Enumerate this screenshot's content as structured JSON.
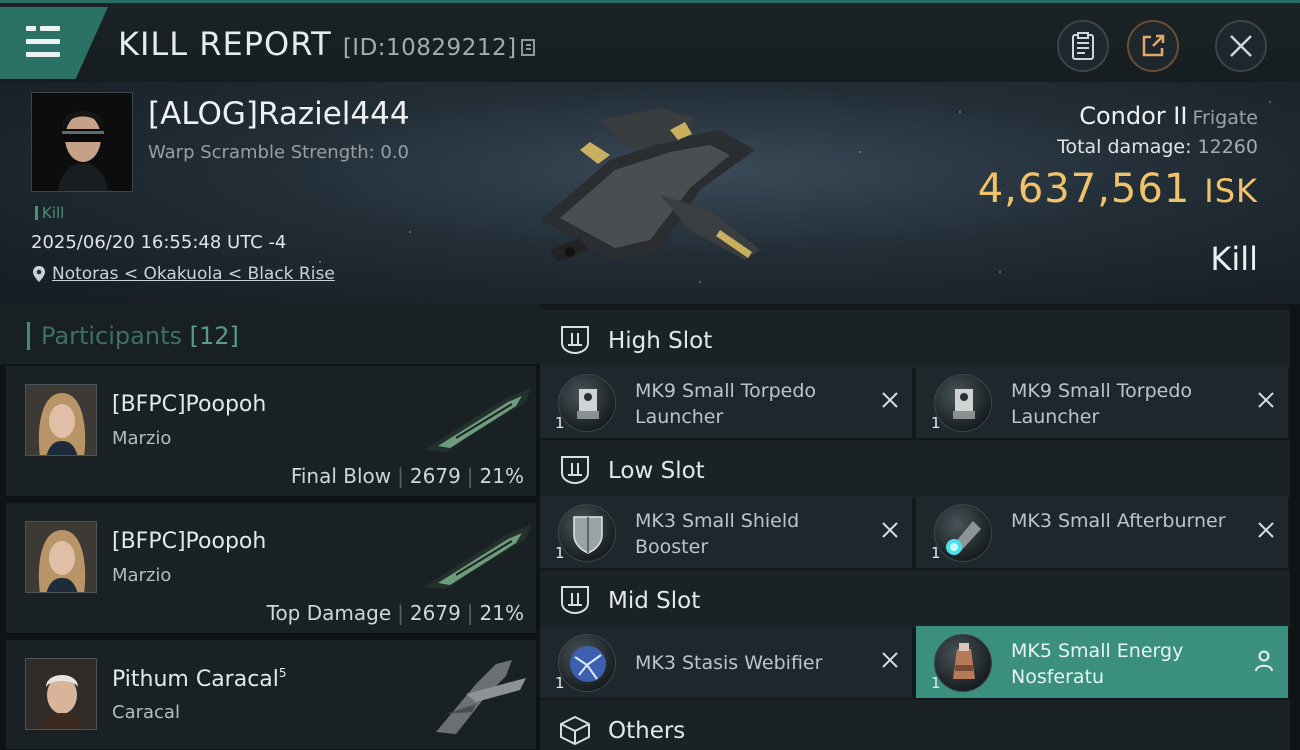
{
  "header": {
    "title": "KILL REPORT",
    "report_id": "[ID:10829212]"
  },
  "victim": {
    "name": "[ALOG]Raziel444",
    "warp_scramble": "Warp Scramble Strength: 0.0",
    "tag": "Kill",
    "time": "2025/06/20 16:55:48 UTC -4",
    "location": "Notoras < Okakuola < Black Rise",
    "ship_name": "Condor II",
    "ship_class": "Frigate",
    "damage_label": "Total damage:",
    "damage_value": "12260",
    "isk_value": "4,637,561",
    "isk_unit": "ISK",
    "result": "Kill"
  },
  "participants": {
    "title": "Participants",
    "count": "[12]",
    "rows": [
      {
        "name": "[BFPC]Poopoh",
        "ship": "Marzio",
        "label": "Final Blow",
        "damage": "2679",
        "percent": "21%"
      },
      {
        "name": "[BFPC]Poopoh",
        "ship": "Marzio",
        "label": "Top Damage",
        "damage": "2679",
        "percent": "21%"
      },
      {
        "name": "Pithum Caracal",
        "sup": "5",
        "ship": "Caracal"
      }
    ]
  },
  "fitting": {
    "high": {
      "title": "High Slot",
      "modules": [
        {
          "qty": "1",
          "name": "MK9 Small Torpedo Launcher",
          "icon": "torpedo-launcher-icon"
        },
        {
          "qty": "1",
          "name": "MK9 Small Torpedo Launcher",
          "icon": "torpedo-launcher-icon"
        }
      ]
    },
    "low": {
      "title": "Low Slot",
      "modules": [
        {
          "qty": "1",
          "name": "MK3 Small Shield Booster",
          "icon": "shield-booster-icon"
        },
        {
          "qty": "1",
          "name": "MK3 Small Afterburner",
          "icon": "afterburner-icon"
        }
      ]
    },
    "mid": {
      "title": "Mid Slot",
      "modules": [
        {
          "qty": "1",
          "name": "MK3 Stasis Webifier",
          "icon": "stasis-webifier-icon"
        },
        {
          "qty": "1",
          "name": "MK5 Small Energy Nosferatu",
          "icon": "energy-nosferatu-icon"
        }
      ]
    },
    "others": {
      "title": "Others"
    }
  },
  "colors": {
    "accent_teal": "#2b7165",
    "isk_gold": "#efc36a",
    "highlight_row": "#3a8f7f"
  }
}
